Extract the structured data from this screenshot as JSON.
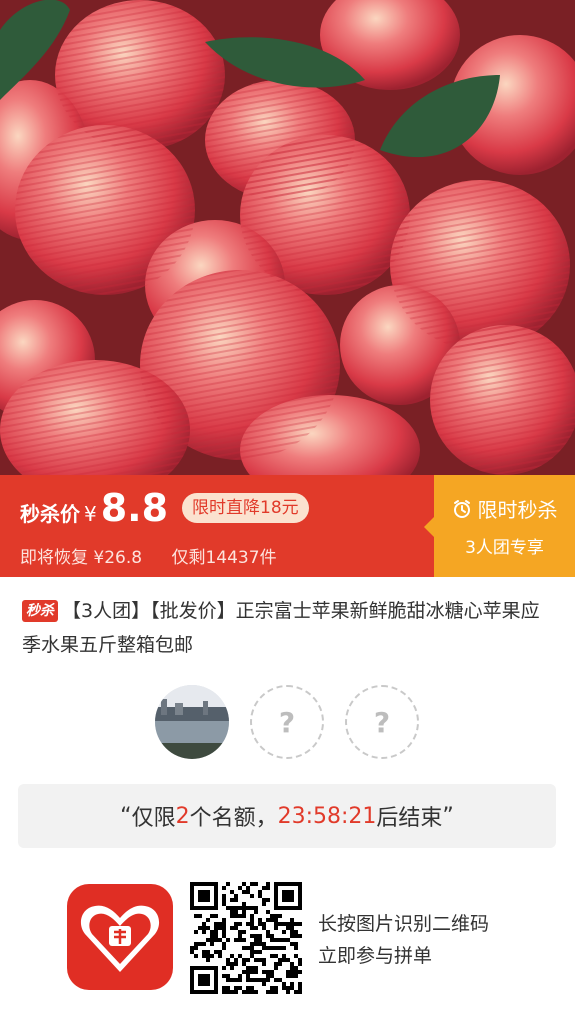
{
  "hero": {
    "image": "apples-with-leaves-photo"
  },
  "price": {
    "label": "秒杀价",
    "currency": "¥",
    "value": "8.8",
    "drop_badge": "限时直降18元",
    "restore_text": "即将恢复 ¥26.8",
    "remaining_text": "仅剩14437件",
    "flash_title": "限时秒杀",
    "flash_subtitle": "3人团专享",
    "clock_icon": "alarm-clock-icon"
  },
  "product": {
    "tag": "秒杀",
    "title": "【3人团】【批发价】正宗富士苹果新鲜脆甜冰糖心苹果应季水果五斤整箱包邮"
  },
  "group": {
    "slots": [
      {
        "type": "member",
        "avatar": "lake-photo-avatar"
      },
      {
        "type": "empty",
        "placeholder": "?"
      },
      {
        "type": "empty",
        "placeholder": "?"
      }
    ]
  },
  "quota": {
    "open_quote": "“",
    "prefix": "仅限",
    "count": "2",
    "middle": "个名额，",
    "timer": "23:58:21",
    "suffix": "后结束",
    "close_quote": "”"
  },
  "share": {
    "app_logo": "pinduoduo-logo",
    "qr": "qr-code",
    "line1": "长按图片识别二维码",
    "line2": "立即参与拼单"
  },
  "colors": {
    "accent_red": "#e13a2a",
    "flash_orange": "#f5a623",
    "badge_bg": "#fbe2cf"
  }
}
